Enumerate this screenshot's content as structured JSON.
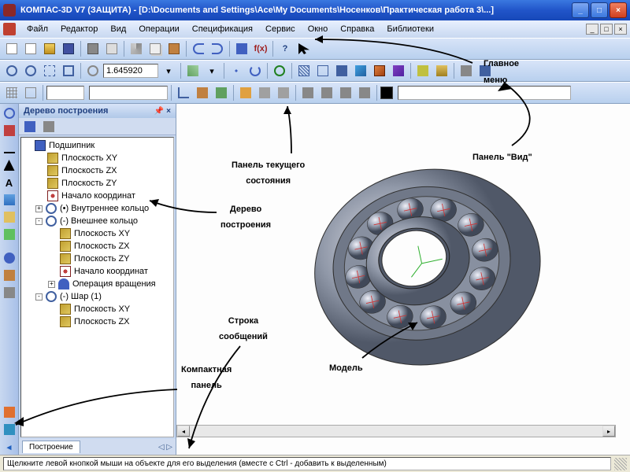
{
  "title": "КОМПАС-3D V7 (ЗАЩИТА) - [D:\\Documents and Settings\\Ace\\My Documents\\Носенков\\Практическая работа 3\\...]",
  "menu": [
    "Файл",
    "Редактор",
    "Вид",
    "Операции",
    "Спецификация",
    "Сервис",
    "Окно",
    "Справка",
    "Библиотеки"
  ],
  "zoom_value": "1.645920",
  "tree": {
    "title": "Дерево построения",
    "root": "Подшипник",
    "planes": [
      "Плоскость XY",
      "Плоскость ZX",
      "Плоскость ZY"
    ],
    "origin": "Начало координат",
    "items": [
      {
        "exp": "+",
        "label": "(•) Внутреннее кольцо",
        "icon": "iring"
      },
      {
        "exp": "-",
        "label": "(-) Внешнее кольцо",
        "icon": "iring",
        "children_planes": [
          "Плоскость XY",
          "Плоскость ZX",
          "Плоскость ZY"
        ],
        "children_origin": "Начало координат",
        "children_op": "Операция вращения"
      },
      {
        "exp": "-",
        "label": "(-) Шар (1)",
        "icon": "iring",
        "children_planes": [
          "Плоскость XY",
          "Плоскость ZX"
        ]
      }
    ],
    "tab": "Построение"
  },
  "status": "Щелкните левой кнопкой мыши на объекте для его выделения (вместе с Ctrl - добавить к выделенным)",
  "annotations": {
    "main_menu": "Главное\nменю",
    "view_panel": "Панель \"Вид\"",
    "state_panel": "Панель текущего\nсостояния",
    "tree_label": "Дерево\nпостроения",
    "msg_line": "Строка\nсообщений",
    "compact": "Компактная\nпанель",
    "model": "Модель"
  },
  "toolbar_fx": "f(x)"
}
